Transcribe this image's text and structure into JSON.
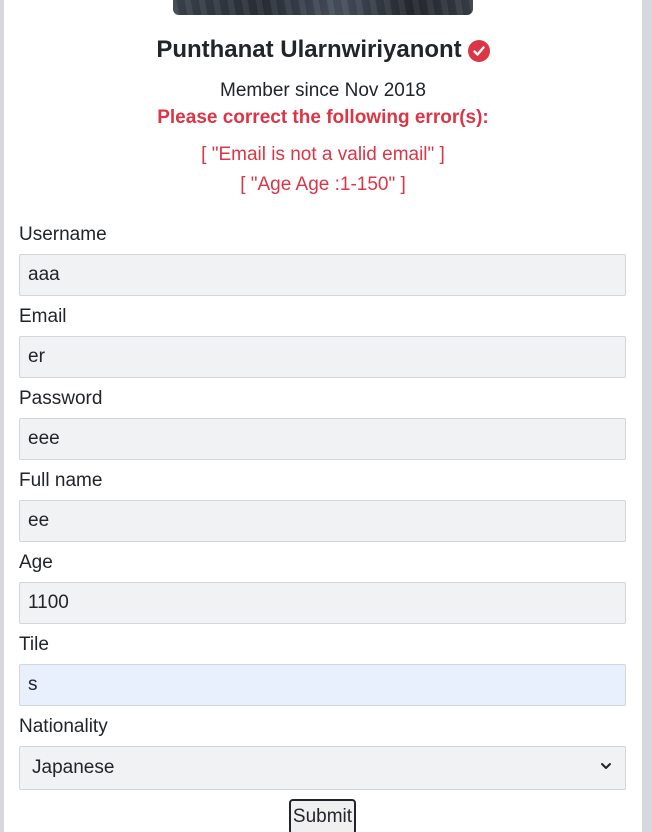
{
  "profile": {
    "name": "Punthanat Ularnwiriyanont",
    "member_since": "Member since Nov 2018"
  },
  "errors": {
    "title": "Please correct the following error(s):",
    "items": [
      "[ \"Email is not a valid email\" ]",
      "[ \"Age Age :1-150\" ]"
    ]
  },
  "form": {
    "username": {
      "label": "Username",
      "value": "aaa"
    },
    "email": {
      "label": "Email",
      "value": "er"
    },
    "password": {
      "label": "Password",
      "value": "eee"
    },
    "fullname": {
      "label": "Full name",
      "value": "ee"
    },
    "age": {
      "label": "Age",
      "value": "1100"
    },
    "tile": {
      "label": "Tile",
      "value": "s"
    },
    "nationality": {
      "label": "Nationality",
      "selected": "Japanese"
    },
    "submit_label": "Submit"
  },
  "icons": {
    "verified": "check-circle-icon",
    "dropdown": "chevron-down-icon"
  },
  "colors": {
    "error": "#dc3545",
    "verified_badge": "#dc3545",
    "input_bg": "#f1f2f4",
    "focused_input_bg": "#e8f0fe"
  }
}
